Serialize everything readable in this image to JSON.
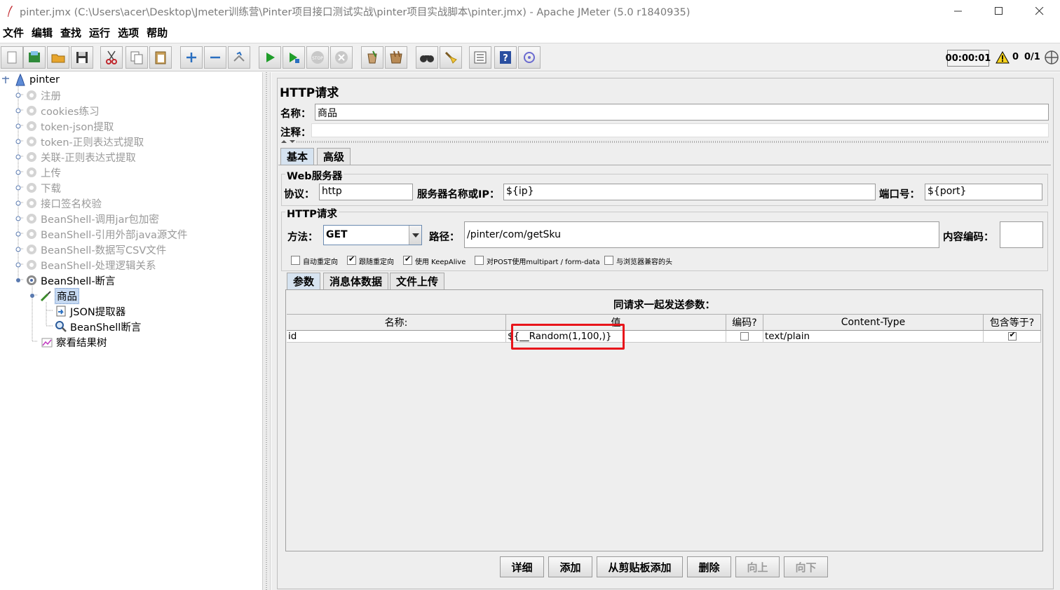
{
  "window": {
    "title": "pinter.jmx (C:\\Users\\acer\\Desktop\\Jmeter训练营\\Pinter项目接口测试实战\\pinter项目实战脚本\\pinter.jmx) - Apache JMeter (5.0 r1840935)"
  },
  "menu": [
    "文件",
    "编辑",
    "查找",
    "运行",
    "选项",
    "帮助"
  ],
  "toolbar": {
    "timer": "00:00:01",
    "warning_count": "0",
    "threads": "0/1",
    "buttons": [
      "new-icon",
      "templates-icon",
      "open-icon",
      "save-icon",
      "cut-icon",
      "copy-icon",
      "paste-icon",
      "expand-icon",
      "collapse-icon",
      "toggle-icon",
      "start-icon",
      "start-no-pause-icon",
      "stop-icon",
      "shutdown-icon",
      "clear-icon",
      "clear-all-icon",
      "search-icon",
      "reset-search-icon",
      "function-helper-icon",
      "help-icon",
      "remote-icon"
    ]
  },
  "tree": {
    "root": "pinter",
    "items": [
      "注册",
      "cookies练习",
      "token-json提取",
      "token-正则表达式提取",
      "关联-正则表达式提取",
      "上传",
      "下载",
      "接口签名校验",
      "BeanShell-调用jar包加密",
      "BeanShell-引用外部java源文件",
      "BeanShell-数据写CSV文件",
      "BeanShell-处理逻辑关系",
      "BeanShell-断言"
    ],
    "selected": "商品",
    "children": [
      "JSON提取器",
      "BeanShell断言"
    ],
    "listener": "察看结果树"
  },
  "panel": {
    "heading": "HTTP请求",
    "name_label": "名称：",
    "name_value": "商品",
    "comment_label": "注释：",
    "comment_value": "",
    "tabs": [
      "基本",
      "高级"
    ],
    "web_server": {
      "legend": "Web服务器",
      "protocol_label": "协议：",
      "protocol_value": "http",
      "server_label": "服务器名称或IP：",
      "server_value": "${ip}",
      "port_label": "端口号：",
      "port_value": "${port}"
    },
    "http_request": {
      "legend": "HTTP请求",
      "method_label": "方法：",
      "method_value": "GET",
      "path_label": "路径：",
      "path_value": "/pinter/com/getSku",
      "encoding_label": "内容编码：",
      "encoding_value": ""
    },
    "options": [
      {
        "label": "自动重定向",
        "checked": false
      },
      {
        "label": "跟随重定向",
        "checked": true
      },
      {
        "label": "使用 KeepAlive",
        "checked": true
      },
      {
        "label": "对POST使用multipart / form-data",
        "checked": false
      },
      {
        "label": "与浏览器兼容的头",
        "checked": false
      }
    ],
    "subtabs": [
      "参数",
      "消息体数据",
      "文件上传"
    ],
    "params_title": "同请求一起发送参数：",
    "columns": [
      "名称:",
      "值",
      "编码?",
      "Content-Type",
      "包含等于?"
    ],
    "rows": [
      {
        "name": "id",
        "value": "${__Random(1,100,)}",
        "encode": false,
        "content_type": "text/plain",
        "include_equals": true
      }
    ],
    "buttons": [
      "详细",
      "添加",
      "从剪贴板添加",
      "删除",
      "向上",
      "向下"
    ]
  }
}
